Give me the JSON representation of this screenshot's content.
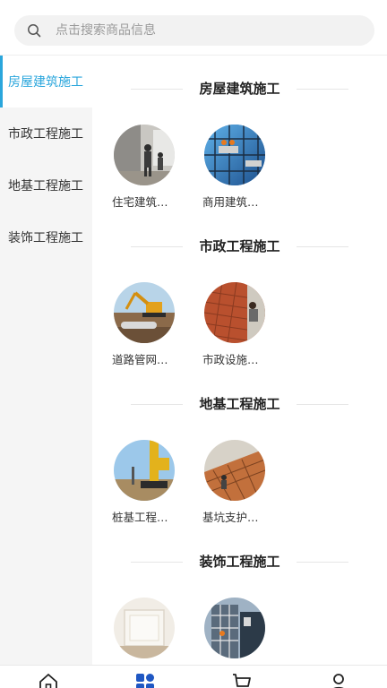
{
  "search": {
    "placeholder": "点击搜索商品信息"
  },
  "sidebar": {
    "items": [
      {
        "label": "房屋建筑施工",
        "active": true
      },
      {
        "label": "市政工程施工",
        "active": false
      },
      {
        "label": "地基工程施工",
        "active": false
      },
      {
        "label": "装饰工程施工",
        "active": false
      }
    ]
  },
  "sections": [
    {
      "title": "房屋建筑施工",
      "items": [
        {
          "label": "住宅建筑…",
          "image": "interior-worker-photo"
        },
        {
          "label": "商用建筑…",
          "image": "glass-facade-photo"
        }
      ]
    },
    {
      "title": "市政工程施工",
      "items": [
        {
          "label": "道路管网…",
          "image": "excavator-photo"
        },
        {
          "label": "市政设施…",
          "image": "brick-paving-photo"
        }
      ]
    },
    {
      "title": "地基工程施工",
      "items": [
        {
          "label": "桩基工程…",
          "image": "pile-driver-photo"
        },
        {
          "label": "基坑支护…",
          "image": "slope-support-photo"
        }
      ]
    },
    {
      "title": "装饰工程施工",
      "items": [
        {
          "label": "",
          "image": "interior-room-photo"
        },
        {
          "label": "",
          "image": "facade-scaffold-photo"
        }
      ]
    }
  ],
  "bottom_nav": {
    "items": [
      {
        "icon": "home-icon"
      },
      {
        "icon": "category-icon",
        "active": true
      },
      {
        "icon": "cart-icon"
      },
      {
        "icon": "user-icon"
      }
    ]
  },
  "colors": {
    "accent": "#2aa6dc",
    "nav_active": "#1f57c3"
  }
}
